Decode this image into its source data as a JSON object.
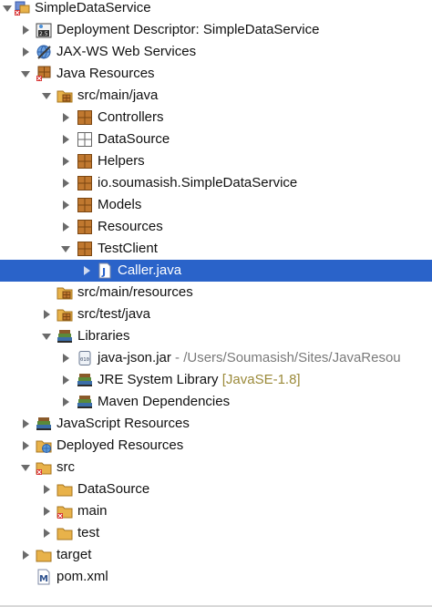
{
  "tree": {
    "items": [
      {
        "label": "SimpleDataService",
        "icon": "project-icon",
        "expanded": true
      },
      {
        "label": "Deployment Descriptor: SimpleDataService",
        "icon": "deployment-descriptor-icon",
        "expanded": false
      },
      {
        "label": "JAX-WS Web Services",
        "icon": "web-services-icon",
        "expanded": false
      },
      {
        "label": "Java Resources",
        "icon": "java-resources-icon",
        "expanded": true
      },
      {
        "label": "src/main/java",
        "icon": "source-folder-icon",
        "expanded": true
      },
      {
        "label": "Controllers",
        "icon": "package-icon",
        "expanded": false
      },
      {
        "label": "DataSource",
        "icon": "empty-package-icon",
        "expanded": false
      },
      {
        "label": "Helpers",
        "icon": "package-icon",
        "expanded": false
      },
      {
        "label": "io.soumasish.SimpleDataService",
        "icon": "package-icon",
        "expanded": false
      },
      {
        "label": "Models",
        "icon": "package-icon",
        "expanded": false
      },
      {
        "label": "Resources",
        "icon": "package-icon",
        "expanded": false
      },
      {
        "label": "TestClient",
        "icon": "package-icon",
        "expanded": true
      },
      {
        "label": "Caller.java",
        "icon": "java-file-icon",
        "expanded": false,
        "selected": true
      },
      {
        "label": "src/main/resources",
        "icon": "source-folder-icon"
      },
      {
        "label": "src/test/java",
        "icon": "source-folder-icon",
        "expanded": false
      },
      {
        "label": "Libraries",
        "icon": "library-icon",
        "expanded": true
      },
      {
        "label": "java-json.jar",
        "secondary": "- /Users/Soumasish/Sites/JavaResou",
        "icon": "jar-icon",
        "expanded": false
      },
      {
        "label": "JRE System Library",
        "decoration": "[JavaSE-1.8]",
        "icon": "library-icon",
        "expanded": false
      },
      {
        "label": "Maven Dependencies",
        "icon": "library-icon",
        "expanded": false
      },
      {
        "label": "JavaScript Resources",
        "icon": "javascript-resources-icon",
        "expanded": false
      },
      {
        "label": "Deployed Resources",
        "icon": "deployed-resources-icon",
        "expanded": false
      },
      {
        "label": "src",
        "icon": "error-folder-icon",
        "expanded": true
      },
      {
        "label": "DataSource",
        "icon": "folder-icon",
        "expanded": false
      },
      {
        "label": "main",
        "icon": "error-folder-icon",
        "expanded": false
      },
      {
        "label": "test",
        "icon": "folder-icon",
        "expanded": false
      },
      {
        "label": "target",
        "icon": "folder-icon",
        "expanded": false
      },
      {
        "label": "pom.xml",
        "icon": "maven-pom-icon"
      }
    ]
  },
  "colors": {
    "selection": "#2a63c9",
    "package": "#c0782f",
    "folder": "#e8b24a",
    "error": "#d62b2b",
    "decoration": "#9b8a3a",
    "secondary": "#7a7a7a"
  }
}
